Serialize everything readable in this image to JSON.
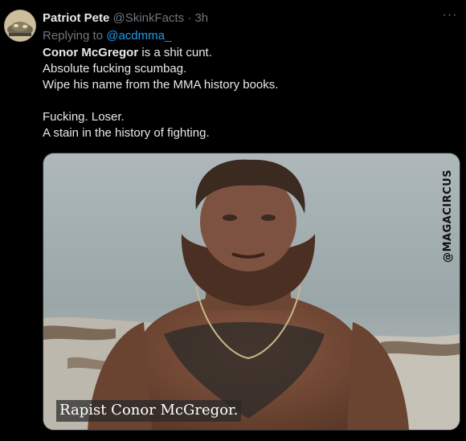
{
  "tweet": {
    "display_name": "Patriot Pete",
    "handle": "@SkinkFacts",
    "separator": "·",
    "time": "3h",
    "more_glyph": "···",
    "replying_prefix": "Replying to ",
    "replying_to": "@acdmma_",
    "lines": {
      "l1_bold": "Conor McGregor",
      "l1_rest": " is a shit cunt.",
      "l2": "Absolute fucking scumbag.",
      "l3": "Wipe his name from the MMA history books.",
      "l4": "Fucking. Loser.",
      "l5": "A stain in the history of fighting."
    },
    "media": {
      "watermark": "@MAGACIRCUS",
      "caption": "Rapist Conor McGregor."
    }
  },
  "colors": {
    "background": "#000000",
    "text": "#e7e9ea",
    "muted": "#71767b",
    "link": "#1d9bf0"
  },
  "icons": {
    "more": "more-horizontal-icon"
  }
}
